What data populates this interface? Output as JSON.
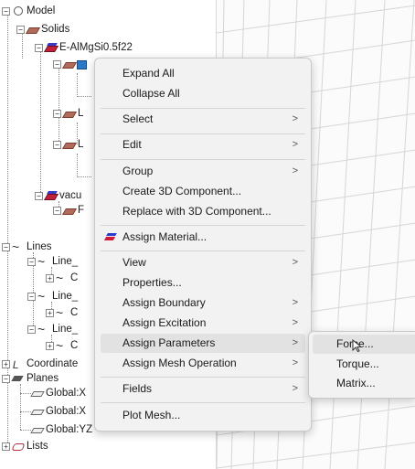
{
  "tree": {
    "model": "Model",
    "solids": "Solids",
    "material": "E-AlMgSi0.5f22",
    "l1": "L",
    "l2": "L",
    "vacuum": "vacu",
    "vacuum_child": "F",
    "lines": "Lines",
    "line_a": "Line_",
    "line_a_child": "C",
    "line_b": "Line_",
    "line_b_child": "C",
    "line_c": "Line_",
    "line_c_child": "C",
    "coordinate": "Coordinate",
    "planes": "Planes",
    "plane_x1": "Global:X",
    "plane_x2": "Global:X",
    "plane_yz": "Global:YZ",
    "lists": "Lists"
  },
  "context_menu": {
    "expand_all": "Expand All",
    "collapse_all": "Collapse All",
    "select": "Select",
    "edit": "Edit",
    "group": "Group",
    "create_3d_component": "Create 3D Component...",
    "replace_3d_component": "Replace with 3D Component...",
    "assign_material": "Assign Material...",
    "view": "View",
    "properties": "Properties...",
    "assign_boundary": "Assign Boundary",
    "assign_excitation": "Assign Excitation",
    "assign_parameters": "Assign Parameters",
    "assign_mesh_operation": "Assign Mesh Operation",
    "fields": "Fields",
    "plot_mesh": "Plot Mesh...",
    "arrow": ">"
  },
  "submenu": {
    "force": "Force...",
    "torque": "Torque...",
    "matrix": "Matrix..."
  },
  "icons": {
    "tree_toggle": "collapse-box",
    "material": "material-icon",
    "cursor": "mouse-pointer"
  },
  "colors": {
    "menu_bg": "#f2f2f2",
    "hover_bg": "#e2e2e2",
    "material_red": "#d01c3a",
    "material_blue": "#2b3bd0"
  }
}
